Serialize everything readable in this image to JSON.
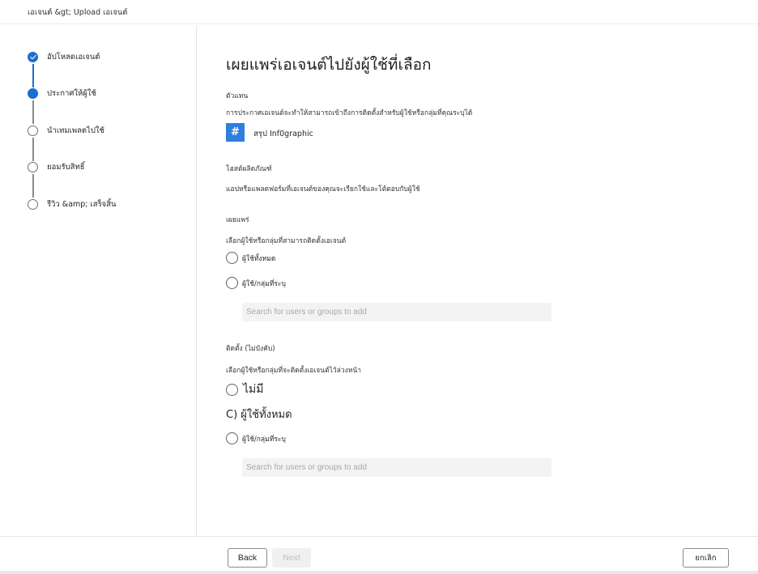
{
  "breadcrumb": "เอเจนต์ &gt; Upload เอเจนต์",
  "steps": [
    {
      "label": "อัปโหลดเอเจนต์",
      "state": "done"
    },
    {
      "label": "ประกาศให้ผู้ใช้",
      "state": "current"
    },
    {
      "label": "นำเทมเพลตไปใช้",
      "state": "pending"
    },
    {
      "label": "ยอมรับสิทธิ์",
      "state": "pending"
    },
    {
      "label": "รีวิว &amp; เสร็จสิ้น",
      "state": "pending"
    }
  ],
  "main": {
    "title": "เผยแพร่เอเจนต์ไปยังผู้ใช้ที่เลือก",
    "representative_label": "ตัวแทน",
    "representative_desc": "การประกาศเอเจนต์จะทำให้สามารถเข้าถึงการติดตั้งสำหรับผู้ใช้หรือกลุ่มที่คุณระบุได้",
    "agent_icon_glyph": "#",
    "agent_name": "สรุป Inf0graphic",
    "host_label": "โฮสต์ผลิตภัณฑ์",
    "host_desc": "แอปหรือแพลตฟอร์มที่เอเจนต์ของคุณจะเรียกใช้และโต้ตอบกับผู้ใช้",
    "publish_label": "เผยแพร่",
    "publish_desc": "เลือกผู้ใช้หรือกลุ่มที่สามารถติดตั้งเอเจนต์",
    "publish_options": [
      "ผู้ใช้ทั้งหมด",
      "ผู้ใช้/กลุ่มที่ระบุ"
    ],
    "publish_search_placeholder": "Search for users or groups to add",
    "install_label": "ติดตั้ง (ไม่บังคับ)",
    "install_desc": "เลือกผู้ใช้หรือกลุ่มที่จะติดตั้งเอเจนต์ไว้ล่วงหน้า",
    "install_option_none": "ไม่มี",
    "install_option_all_text": "C) ผู้ใช้ทั้งหมด",
    "install_option_specific": "ผู้ใช้/กลุ่มที่ระบุ",
    "install_search_placeholder": "Search for users or groups to add"
  },
  "footer": {
    "back_label": "Back",
    "next_label": "Next",
    "cancel_label": "ยกเลิก"
  },
  "colors": {
    "accent": "#1a6fd1",
    "agent_icon_bg": "#2f7fde"
  }
}
